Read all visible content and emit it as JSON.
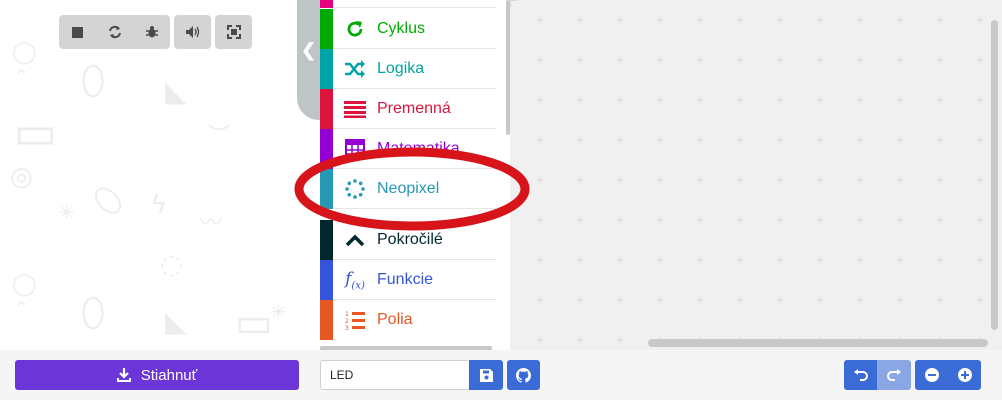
{
  "simulator": {
    "toolbar": {
      "stop_icon": "stop-icon",
      "restart_icon": "restart-icon",
      "debug_icon": "bug-icon",
      "sound_icon": "volume-icon",
      "fullscreen_icon": "fullscreen-icon"
    }
  },
  "toolbox": {
    "categories": [
      {
        "label": "",
        "color": "#e6007e",
        "icon": ""
      },
      {
        "label": "Cyklus",
        "color": "#00aa00",
        "icon": "loop-icon"
      },
      {
        "label": "Logika",
        "color": "#00a4a6",
        "icon": "shuffle-icon"
      },
      {
        "label": "Premenná",
        "color": "#dc143c",
        "icon": "variable-icon"
      },
      {
        "label": "Matematika",
        "color": "#9400d3",
        "icon": "calculator-icon"
      },
      {
        "label": "Neopixel",
        "color": "#2699b4",
        "icon": "neopixel-icon"
      },
      {
        "label": "Pokročilé",
        "color": "#00272b",
        "icon": "chevron-up-icon"
      },
      {
        "label": "Funkcie",
        "color": "#3455db",
        "icon": "function-icon"
      },
      {
        "label": "Polia",
        "color": "#e65722",
        "icon": "list-icon"
      }
    ]
  },
  "footer": {
    "download_label": "Stiahnuť",
    "project_name": "LED",
    "colors": {
      "download": "#6c35d8",
      "action": "#3a6bd6",
      "annotation": "#d7141a"
    }
  }
}
